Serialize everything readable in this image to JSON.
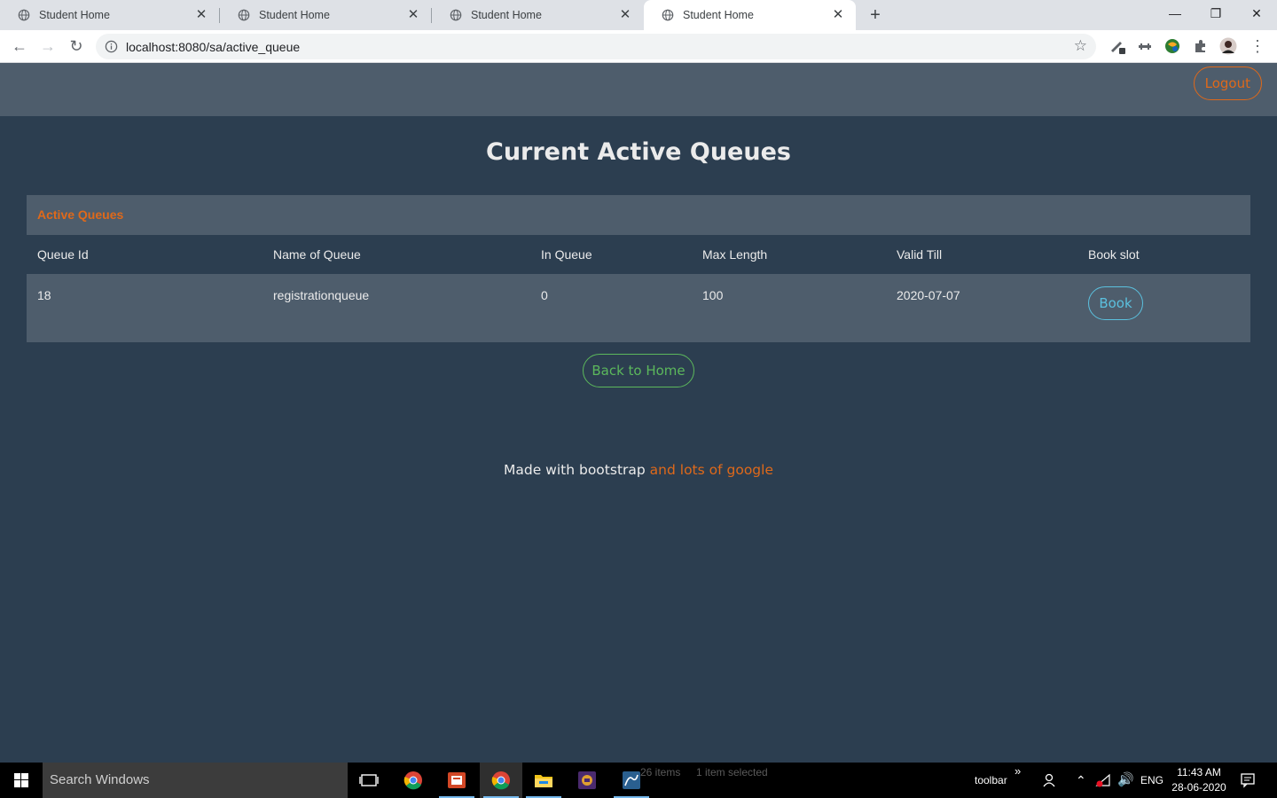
{
  "browser": {
    "tabs": [
      {
        "title": "Student Home"
      },
      {
        "title": "Student Home"
      },
      {
        "title": "Student Home"
      },
      {
        "title": "Student Home"
      }
    ],
    "url": "localhost:8080/sa/active_queue"
  },
  "navbar": {
    "logout_label": "Logout"
  },
  "page": {
    "title": "Current Active Queues",
    "panel_heading": "Active Queues",
    "table": {
      "headers": [
        "Queue Id",
        "Name of Queue",
        "In Queue",
        "Max Length",
        "Valid Till",
        "Book slot"
      ],
      "rows": [
        {
          "queue_id": "18",
          "name": "registrationqueue",
          "in_queue": "0",
          "max_length": "100",
          "valid_till": "2020-07-07",
          "action_label": "Book"
        }
      ]
    },
    "back_label": "Back to Home",
    "footer_text": "Made with bootstrap",
    "footer_link": "and lots of google"
  },
  "taskbar": {
    "search_placeholder": "Search Windows",
    "explorer_ghost": "26 items",
    "explorer_ghost_selected": "1 item selected",
    "toolbar_label": "toolbar",
    "language": "ENG",
    "time": "11:43 AM",
    "date": "28-06-2020"
  },
  "colors": {
    "page_bg": "#2c3e50",
    "navbar_bg": "#4e5d6c",
    "accent_orange": "#df691a",
    "info_blue": "#5bc0de",
    "success_green": "#5cb85c"
  }
}
